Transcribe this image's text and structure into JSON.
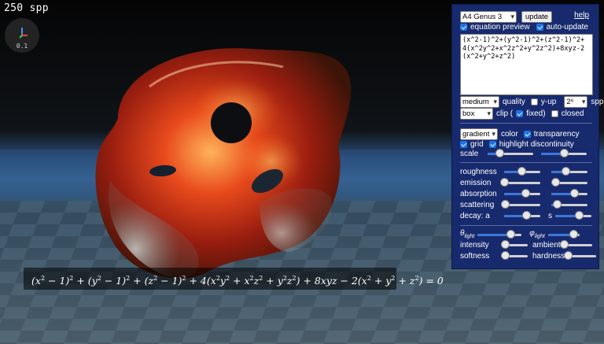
{
  "hud": {
    "spp_text": "250 spp",
    "gizmo_scale": "0.1"
  },
  "equation": {
    "latex": "(x^2-1)^2+(y^2-1)^2+(z^2-1)^2+4(x^2y^2+x^2z^2+y^2z^2)+8xyz-2(x^2+y^2+z^2)=0"
  },
  "panel": {
    "preset": "A4 Genus 3",
    "update_label": "update",
    "help_label": "help",
    "equation_preview": {
      "label": "equation preview",
      "checked": true
    },
    "auto_update": {
      "label": "auto-update",
      "checked": true
    },
    "equation_text": "(x^2-1)^2+(y^2-1)^2+(z^2-1)^2+\n4(x^2y^2+x^2z^2+y^2z^2)+8xyz-2\n(x^2+y^2+z^2)",
    "quality": {
      "value": "medium",
      "label": "quality"
    },
    "y_up": {
      "label": "y-up",
      "checked": false
    },
    "spp": {
      "value": "2⁶",
      "label": "spp"
    },
    "clip": {
      "value": "box",
      "label": "clip ("
    },
    "fixed": {
      "label": "fixed)",
      "checked": true
    },
    "closed": {
      "label": "closed",
      "checked": false
    },
    "color": {
      "value": "gradient",
      "label": "color"
    },
    "transparency": {
      "label": "transparency",
      "checked": true
    },
    "grid": {
      "label": "grid",
      "checked": true
    },
    "highlight": {
      "label": "highlight discontinuity",
      "checked": true
    },
    "scale_label": "scale",
    "material": {
      "roughness": "roughness",
      "emission": "emission",
      "absorption": "absorption",
      "scattering": "scattering",
      "decay_label": "decay: a",
      "decay_s": "s"
    },
    "lighting": {
      "theta_label": "θ",
      "theta_sub": "light",
      "phi_label": "φ",
      "phi_sub": "light",
      "intensity": "intensity",
      "ambient": "ambient",
      "softness": "softness",
      "hardness": "hardness"
    },
    "sliders": {
      "scale_a": 0.25,
      "scale_b": 0.5,
      "roughness_a": 0.48,
      "roughness_b": 0.4,
      "emission_a": 0.0,
      "emission_b": 0.1,
      "absorption_a": 0.58,
      "absorption_b": 0.62,
      "scattering_a": 0.02,
      "scattering_b": 0.15,
      "decay_a": 0.6,
      "decay_s": 0.65,
      "theta": 0.75,
      "phi": 0.8,
      "intensity": 0.15,
      "ambient": 0.0,
      "softness": 0.15,
      "hardness": 0.0
    }
  }
}
